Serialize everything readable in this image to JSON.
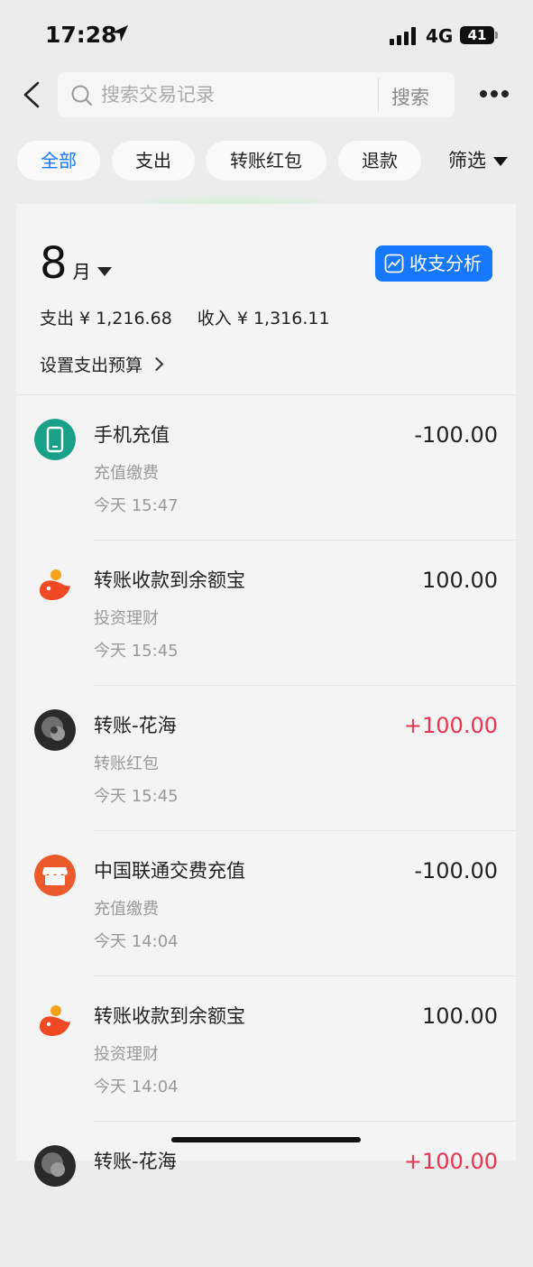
{
  "status_bar": {
    "time": "17:28",
    "network": "4G",
    "battery": "41"
  },
  "nav": {
    "search_placeholder": "搜索交易记录",
    "search_button": "搜索"
  },
  "filters": {
    "chips": [
      {
        "label": "全部",
        "active": true
      },
      {
        "label": "支出",
        "active": false
      },
      {
        "label": "转账红包",
        "active": false
      },
      {
        "label": "退款",
        "active": false
      }
    ],
    "filter_label": "筛选"
  },
  "summary": {
    "month_number": "8",
    "month_unit": "月",
    "analysis_button": "收支分析",
    "expense": "支出 ¥ 1,216.68",
    "income": "收入 ¥ 1,316.11",
    "budget_link": "设置支出预算"
  },
  "transactions": [
    {
      "title": "手机充值",
      "category": "充值缴费",
      "time": "今天 15:47",
      "amount": "-100.00",
      "icon": "phone-topup-icon"
    },
    {
      "title": "转账收款到余额宝",
      "category": "投资理财",
      "time": "今天 15:45",
      "amount": "100.00",
      "icon": "yuebao-icon"
    },
    {
      "title": "转账-花海",
      "category": "转账红包",
      "time": "今天 15:45",
      "amount": "+100.00",
      "icon": "user-avatar"
    },
    {
      "title": "中国联通交费充值",
      "category": "充值缴费",
      "time": "今天 14:04",
      "amount": "-100.00",
      "icon": "shop-icon"
    },
    {
      "title": "转账收款到余额宝",
      "category": "投资理财",
      "time": "今天 14:04",
      "amount": "100.00",
      "icon": "yuebao-icon"
    },
    {
      "title": "转账-花海",
      "category": "",
      "time": "",
      "amount": "+100.00",
      "icon": "user-avatar"
    }
  ],
  "colors": {
    "accent": "#1677ff",
    "income_red": "#e8344e",
    "phone_teal": "#19a089",
    "yuebao_red": "#f04a24",
    "shop_orange": "#ea5a2a"
  }
}
